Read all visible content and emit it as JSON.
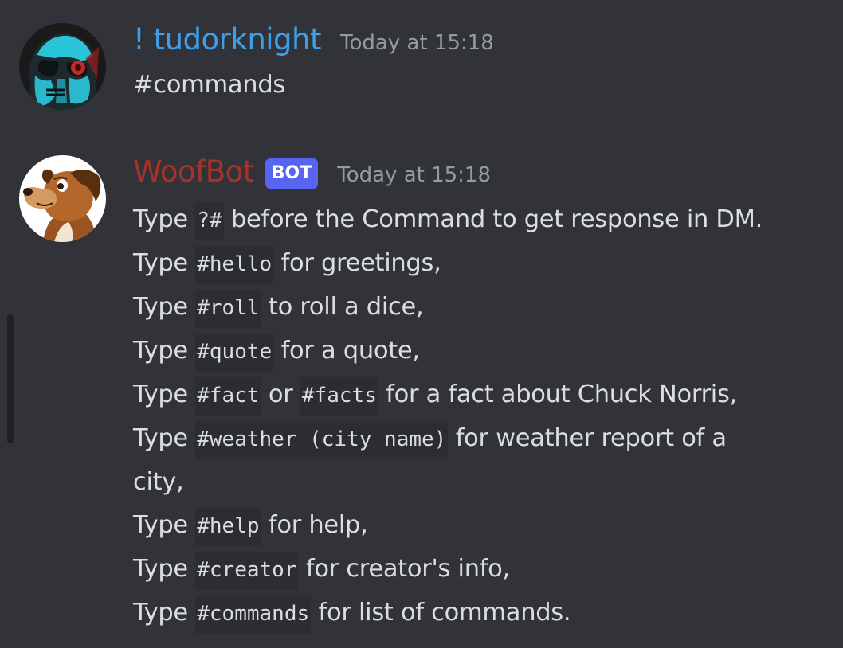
{
  "messages": [
    {
      "author": "! tudorknight",
      "author_color": "#3e9ee6",
      "timestamp": "Today at 15:18",
      "text": "#commands",
      "avatar_icon": "stormtrooper-avatar-icon"
    },
    {
      "author": "WoofBot",
      "author_color": "#a8312a",
      "bot_tag": "BOT",
      "timestamp": "Today at 15:18",
      "avatar_icon": "dog-avatar-icon",
      "lines": [
        {
          "pre": "Type ",
          "code": "?#",
          "post": " before the Command to get response in DM."
        },
        {
          "pre": "Type ",
          "code": "#hello",
          "post": " for greetings,"
        },
        {
          "pre": "Type ",
          "code": "#roll",
          "post": " to roll a dice,"
        },
        {
          "pre": "Type ",
          "code": "#quote",
          "post": " for a quote,"
        },
        {
          "pre": "Type ",
          "code": "#fact",
          "mid": " or ",
          "code2": "#facts",
          "post": " for a fact about Chuck Norris,"
        },
        {
          "pre": "Type ",
          "code": "#weather (city name)",
          "post": " for weather report of a"
        },
        {
          "plain": "city,"
        },
        {
          "pre": "Type ",
          "code": "#help",
          "post": " for help,"
        },
        {
          "pre": "Type ",
          "code": "#creator",
          "post": " for creator's info,"
        },
        {
          "pre": "Type ",
          "code": "#commands",
          "post": " for list of commands."
        }
      ]
    }
  ],
  "colors": {
    "background": "#313338",
    "text": "#dbdee1",
    "timestamp": "#949ba4",
    "code_background": "#2b2d31",
    "bot_tag": "#5865f2"
  }
}
